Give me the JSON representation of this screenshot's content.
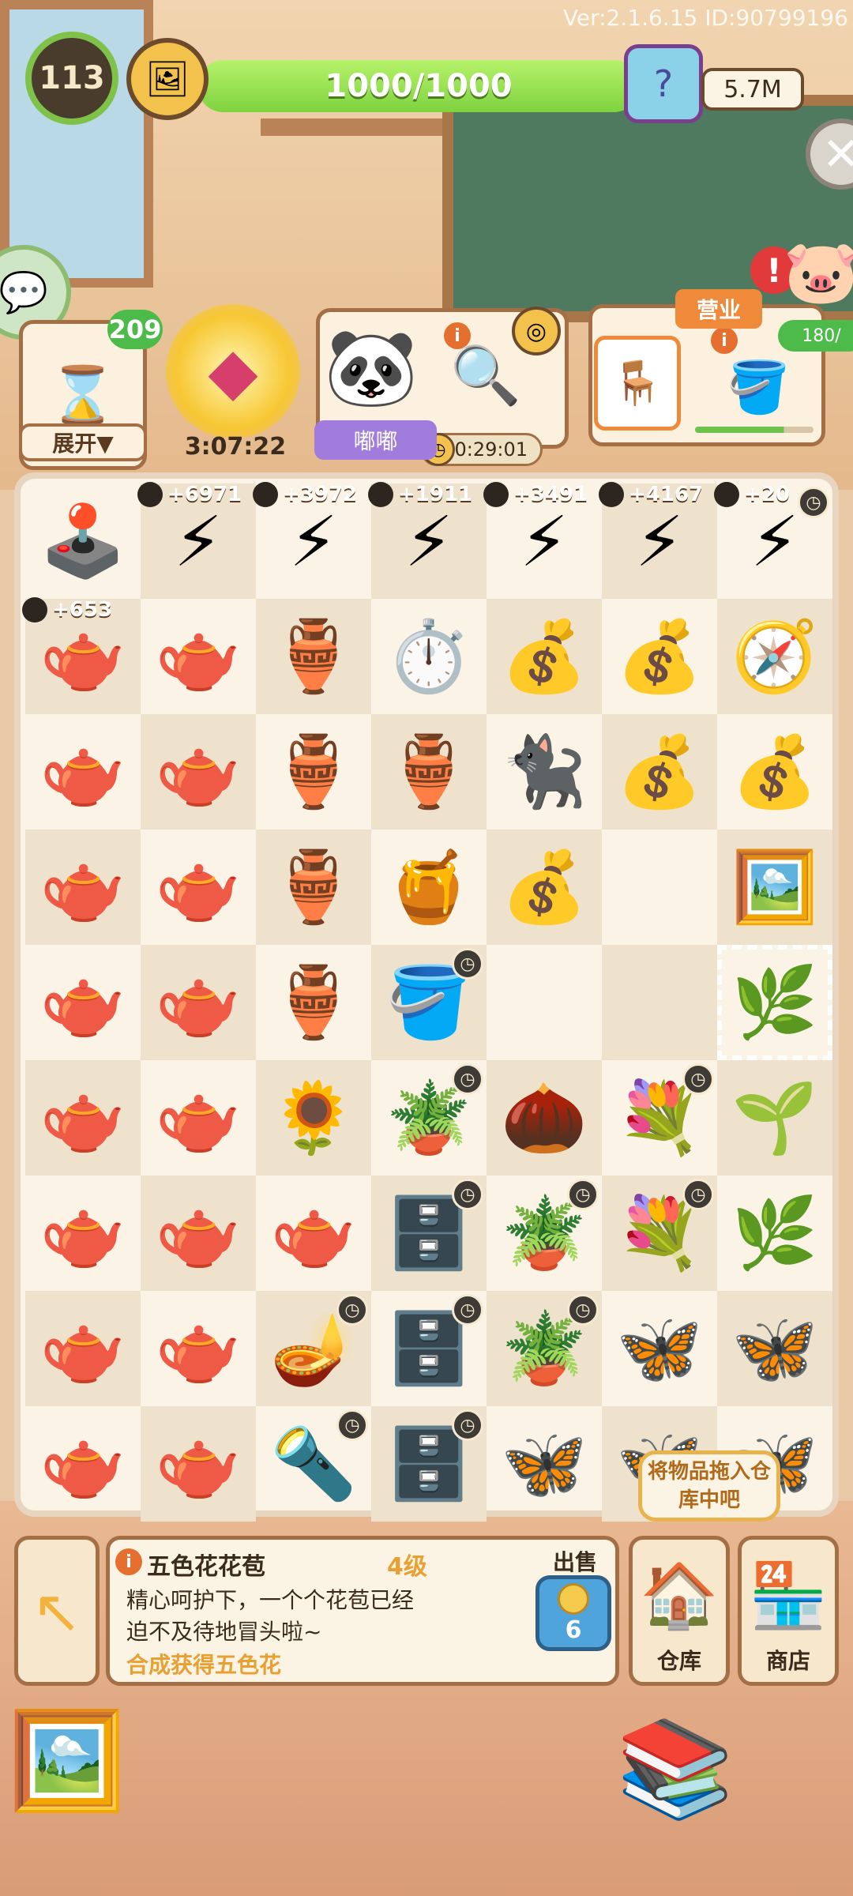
{
  "version": "Ver:2.1.6.15 ID:90799196",
  "hud": {
    "level": "113",
    "xp_text": "1000/1000",
    "xp_fraction": 1.0,
    "coins": "5.7M",
    "medal_icon": "album-medal-icon",
    "gift_icon": "mystery-box-icon"
  },
  "left": {
    "energy": "209",
    "expand_label": "展开▼",
    "gem_timer": "3:07:22"
  },
  "order": {
    "name": "嘟嘟",
    "timer": "0:29:01",
    "item_icon": "magnifier-icon"
  },
  "shop_card": {
    "tag": "营业"
  },
  "pig": {
    "progress": "180/"
  },
  "board": {
    "rows": [
      [
        {
          "i": "🕹️",
          "b": ""
        },
        {
          "i": "⚡",
          "b": "+6971"
        },
        {
          "i": "⚡",
          "b": "+3972"
        },
        {
          "i": "⚡",
          "b": "+1911"
        },
        {
          "i": "⚡",
          "b": "+3491"
        },
        {
          "i": "⚡",
          "b": "+4167"
        },
        {
          "i": "⚡",
          "b": "+20"
        }
      ],
      [
        {
          "i": "🫖",
          "b": "+653"
        },
        {
          "i": "🫖",
          "b": ""
        },
        {
          "i": "🏺",
          "b": ""
        },
        {
          "i": "⏱️",
          "b": ""
        },
        {
          "i": "💰",
          "b": ""
        },
        {
          "i": "💰",
          "b": ""
        },
        {
          "i": "🧭",
          "b": ""
        }
      ],
      [
        {
          "i": "🫖",
          "b": ""
        },
        {
          "i": "🫖",
          "b": ""
        },
        {
          "i": "🏺",
          "b": ""
        },
        {
          "i": "🏺",
          "b": ""
        },
        {
          "i": "🐈‍⬛",
          "b": ""
        },
        {
          "i": "💰",
          "b": ""
        },
        {
          "i": "💰",
          "b": ""
        }
      ],
      [
        {
          "i": "🫖",
          "b": ""
        },
        {
          "i": "🫖",
          "b": ""
        },
        {
          "i": "🏺",
          "b": ""
        },
        {
          "i": "🍯",
          "b": ""
        },
        {
          "i": "💰",
          "b": ""
        },
        {
          "i": "",
          "b": ""
        },
        {
          "i": "🖼️",
          "b": ""
        }
      ],
      [
        {
          "i": "🫖",
          "b": ""
        },
        {
          "i": "🫖",
          "b": ""
        },
        {
          "i": "🏺",
          "b": ""
        },
        {
          "i": "🪣",
          "b": ""
        },
        {
          "i": "",
          "b": ""
        },
        {
          "i": "",
          "b": ""
        },
        {
          "i": "🌿",
          "b": ""
        }
      ],
      [
        {
          "i": "🫖",
          "b": ""
        },
        {
          "i": "🫖",
          "b": ""
        },
        {
          "i": "🌻",
          "b": ""
        },
        {
          "i": "🪴",
          "b": ""
        },
        {
          "i": "🌰",
          "b": ""
        },
        {
          "i": "💐",
          "b": ""
        },
        {
          "i": "🌱",
          "b": ""
        }
      ],
      [
        {
          "i": "🫖",
          "b": ""
        },
        {
          "i": "🫖",
          "b": ""
        },
        {
          "i": "🫖",
          "b": ""
        },
        {
          "i": "🗄️",
          "b": ""
        },
        {
          "i": "🪴",
          "b": ""
        },
        {
          "i": "💐",
          "b": ""
        },
        {
          "i": "🌿",
          "b": ""
        }
      ],
      [
        {
          "i": "🫖",
          "b": ""
        },
        {
          "i": "🫖",
          "b": ""
        },
        {
          "i": "🪔",
          "b": ""
        },
        {
          "i": "🗄️",
          "b": ""
        },
        {
          "i": "🪴",
          "b": ""
        },
        {
          "i": "🦋",
          "b": ""
        },
        {
          "i": "🦋",
          "b": ""
        }
      ],
      [
        {
          "i": "🫖",
          "b": ""
        },
        {
          "i": "🫖",
          "b": ""
        },
        {
          "i": "🔦",
          "b": ""
        },
        {
          "i": "🗄️",
          "b": ""
        },
        {
          "i": "🦋",
          "b": ""
        },
        {
          "i": "🦋",
          "b": ""
        },
        {
          "i": "🦋",
          "b": ""
        }
      ]
    ]
  },
  "item_info": {
    "title": "五色花花苞",
    "level": "4级",
    "desc": "精心呵护下，一个个花苞已经迫不及待地冒头啦~",
    "hint": "合成获得五色花",
    "sell_label": "出售",
    "sell_price": "6"
  },
  "buttons": {
    "warehouse": "仓库",
    "shop": "商店",
    "tooltip": "将物品拖入仓库中吧"
  }
}
